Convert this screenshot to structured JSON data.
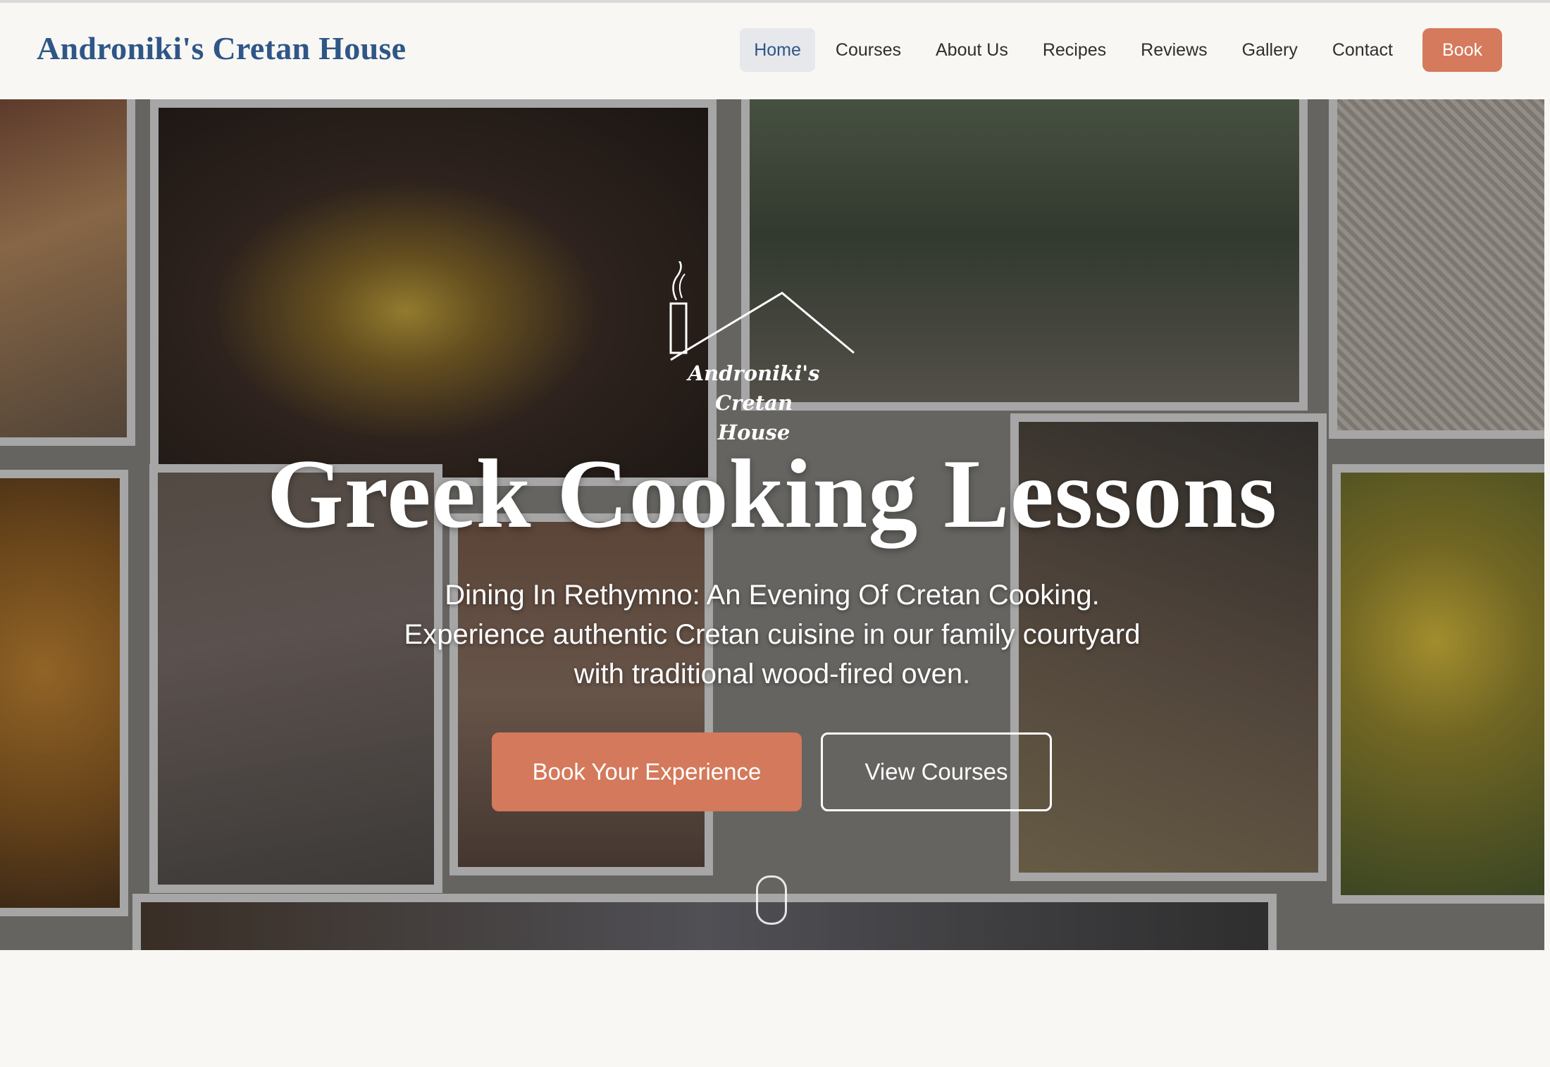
{
  "nav": {
    "brand": "Androniki's Cretan House",
    "items": [
      {
        "label": "Home",
        "active": true
      },
      {
        "label": "Courses"
      },
      {
        "label": "About Us"
      },
      {
        "label": "Recipes"
      },
      {
        "label": "Reviews"
      },
      {
        "label": "Gallery"
      },
      {
        "label": "Contact"
      }
    ],
    "book_label": "Book"
  },
  "hero": {
    "logo_line1": "Androniki's Cretan",
    "logo_line2": "House",
    "headline": "Greek Cooking Lessons",
    "subtitle_lines": [
      "Dining In Rethymno: An Evening Of Cretan Cooking.",
      "Experience authentic Cretan cuisine in our family courtyard",
      "with traditional wood-fired oven."
    ],
    "primary_cta": "Book Your Experience",
    "secondary_cta": "View Courses"
  },
  "colors": {
    "brand_blue": "#2f5687",
    "accent_terracotta": "#d57a5c",
    "background": "#f8f7f4"
  }
}
